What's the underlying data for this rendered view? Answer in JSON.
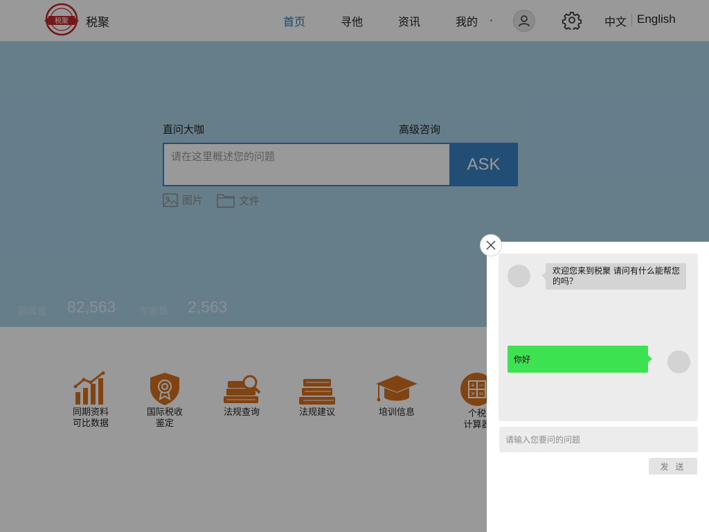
{
  "header": {
    "brand_name": "税聚",
    "logo_text": "税聚",
    "nav": [
      {
        "label": "首页",
        "active": true
      },
      {
        "label": "寻他",
        "active": false
      },
      {
        "label": "资讯",
        "active": false
      },
      {
        "label": "我的",
        "active": false
      }
    ],
    "lang_zh": "中文",
    "lang_en": "English"
  },
  "hero": {
    "direct_ask_label": "直问大咖",
    "advanced_label": "高级咨询",
    "question_placeholder": "请在这里概述您的问题",
    "ask_button": "ASK",
    "attach_image": "图片",
    "attach_file": "文件",
    "stats": {
      "question_count_label": "题库量",
      "question_count_value": "82,563",
      "expert_count_label": "专家数",
      "expert_count_value": "2,563"
    }
  },
  "features": [
    {
      "line1": "同期资料",
      "line2": "可比数据",
      "icon": "bar-chart-icon"
    },
    {
      "line1": "国际税收",
      "line2": "鉴定",
      "icon": "shield-badge-icon"
    },
    {
      "line1": "法规查询",
      "line2": "",
      "icon": "books-search-icon"
    },
    {
      "line1": "法规建议",
      "line2": "",
      "icon": "books-stack-icon"
    },
    {
      "line1": "培训信息",
      "line2": "",
      "icon": "graduation-cap-icon"
    },
    {
      "line1": "个税",
      "line2": "计算器",
      "icon": "calculator-icon"
    }
  ],
  "chat": {
    "bot_message": "欢迎您来到税聚 请问有什么能帮您的吗？",
    "user_message": "你好",
    "input_placeholder": "请输入您要问的问题",
    "send_button": "发 送"
  },
  "colors": {
    "accent": "#3a82c4",
    "hero_bg": "#a8d2e7",
    "feature_orange": "#d9711f",
    "user_bubble": "#3de250"
  }
}
